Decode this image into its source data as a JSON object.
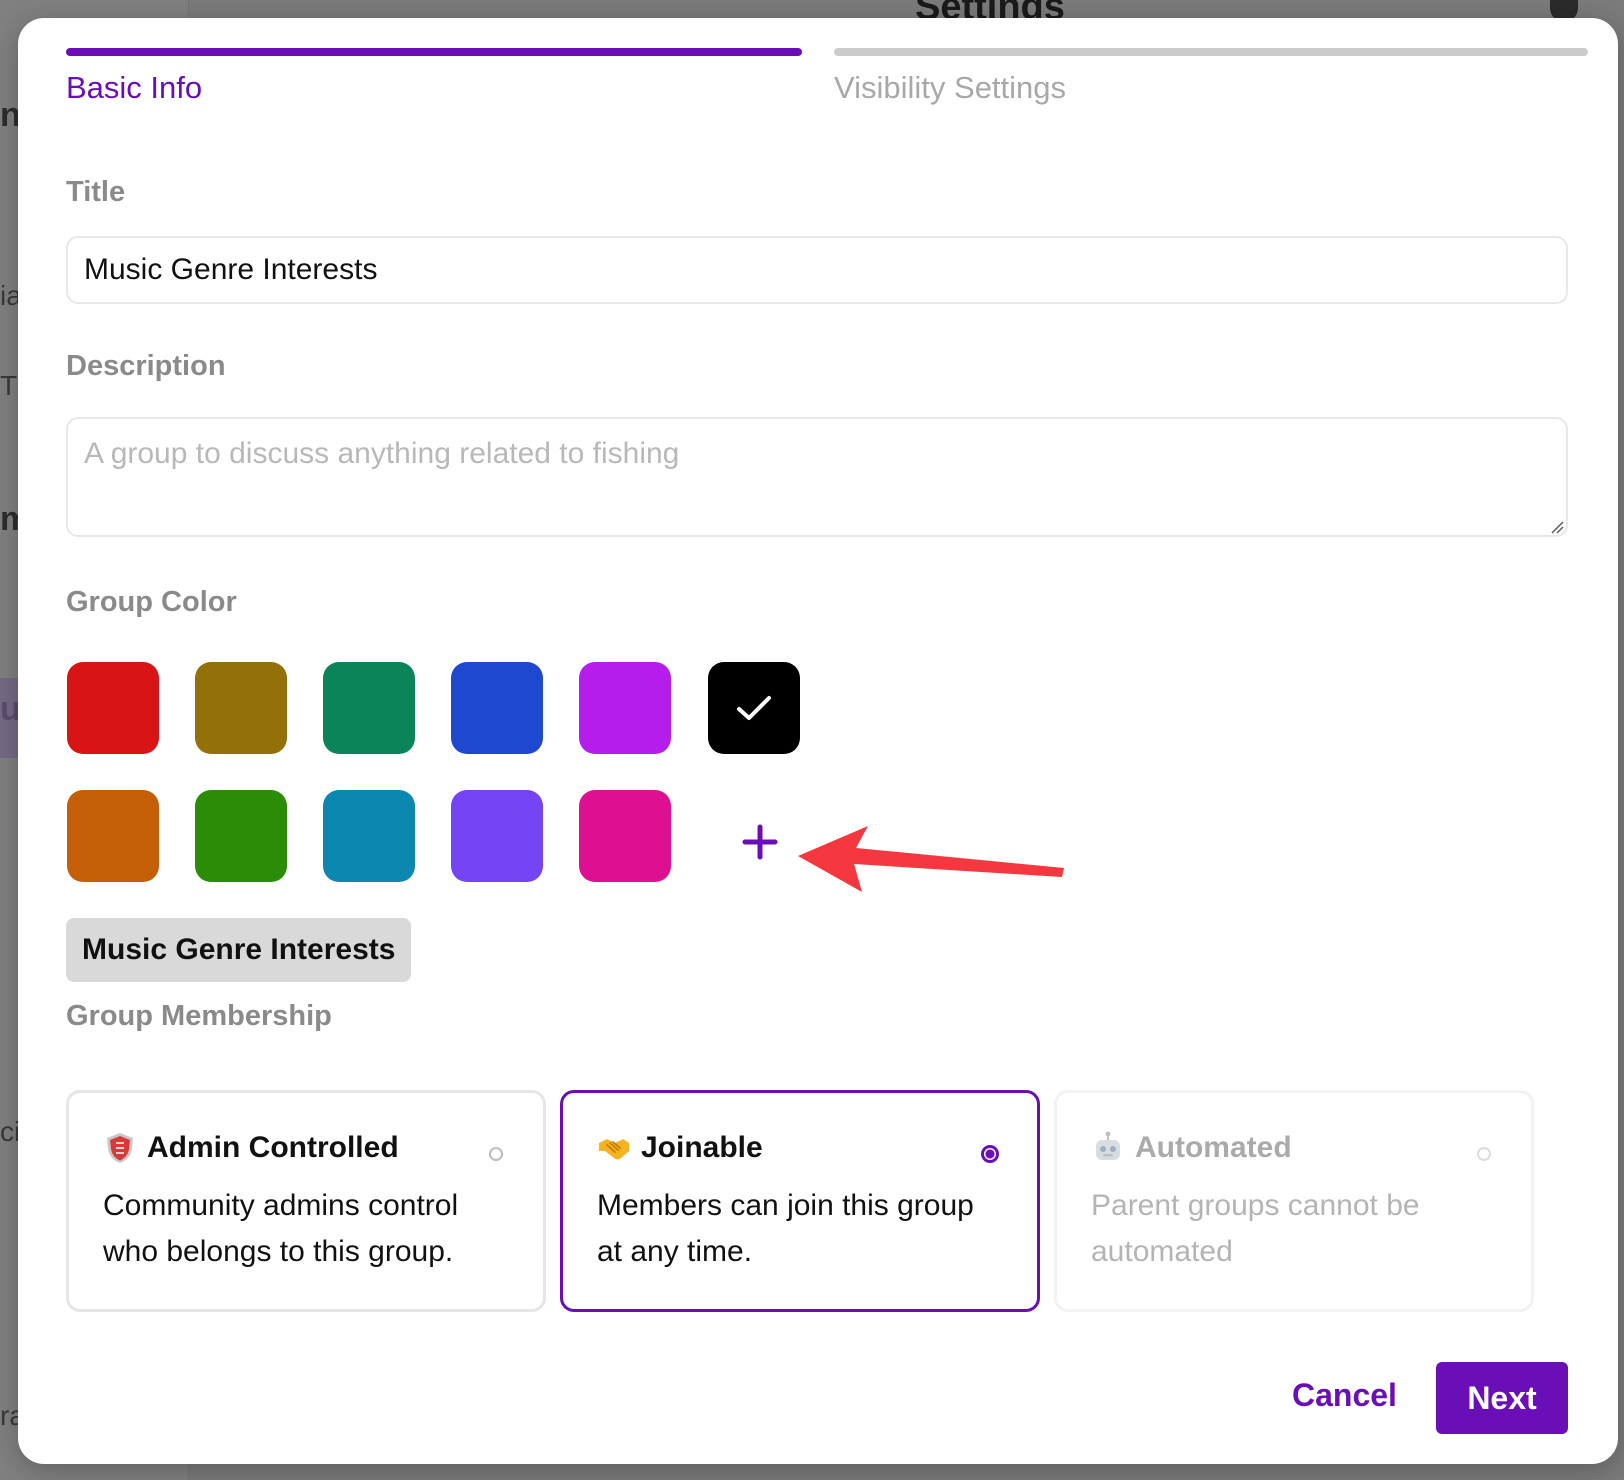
{
  "background": {
    "page_title": "Settings"
  },
  "steps": [
    {
      "label": "Basic Info",
      "active": true
    },
    {
      "label": "Visibility Settings",
      "active": false
    }
  ],
  "title_field": {
    "label": "Title",
    "value": "Music Genre Interests"
  },
  "description_field": {
    "label": "Description",
    "placeholder": "A group to discuss anything related to fishing"
  },
  "group_color": {
    "label": "Group Color",
    "selected": "#000000",
    "swatches": [
      "#d81414",
      "#937108",
      "#0b8459",
      "#1f48d1",
      "#b51ded",
      "#000000",
      "#c45f08",
      "#2b8c08",
      "#0b87b0",
      "#7444f5",
      "#de0f91"
    ],
    "add_icon": "plus-icon",
    "selected_icon": "checkmark-icon",
    "preview_label": "Music Genre Interests",
    "annotation_color": "#f5373f"
  },
  "membership": {
    "label": "Group Membership",
    "options": [
      {
        "title": "Admin Controlled",
        "icon": "shield-icon",
        "description": "Community admins control who belongs to this group.",
        "selected": false,
        "disabled": false
      },
      {
        "title": "Joinable",
        "icon": "handshake-icon",
        "description": "Members can join this group at any time.",
        "selected": true,
        "disabled": false
      },
      {
        "title": "Automated",
        "icon": "robot-icon",
        "description": "Parent groups cannot be automated",
        "selected": false,
        "disabled": true
      }
    ]
  },
  "footer": {
    "cancel_label": "Cancel",
    "next_label": "Next"
  },
  "accent_color": "#6a0fb8"
}
